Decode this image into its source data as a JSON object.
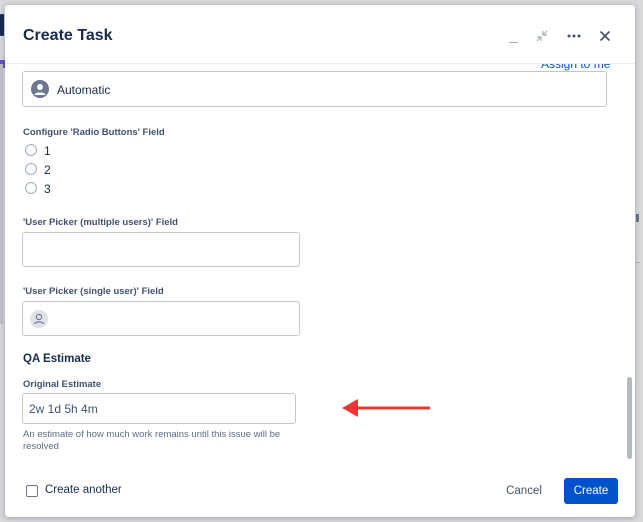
{
  "dialog": {
    "title": "Create Task",
    "controls": {
      "minimize_icon": "minimize-icon",
      "collapse_icon": "collapse-icon",
      "more_icon": "more-icon",
      "close_icon": "close-icon"
    }
  },
  "assignee": {
    "assign_link": "Assign to me",
    "value": "Automatic",
    "icon": "user-avatar-icon"
  },
  "radio_field": {
    "label": "Configure 'Radio Buttons' Field",
    "options": [
      "1",
      "2",
      "3"
    ]
  },
  "user_picker_multi": {
    "label": "'User Picker (multiple users)' Field",
    "value": ""
  },
  "user_picker_single": {
    "label": "'User Picker (single user)' Field",
    "icon": "user-avatar-icon",
    "value": ""
  },
  "qa_estimate": {
    "section_title": "QA Estimate",
    "label": "Original Estimate",
    "value": "2w 1d 5h 4m",
    "help": "An estimate of how much work remains until this issue will be resolved"
  },
  "footer": {
    "create_another": "Create another",
    "create_another_checked": false,
    "cancel": "Cancel",
    "create": "Create"
  },
  "colors": {
    "primary": "#0052cc",
    "text": "#172b4d",
    "annotation_arrow": "#e53935"
  }
}
